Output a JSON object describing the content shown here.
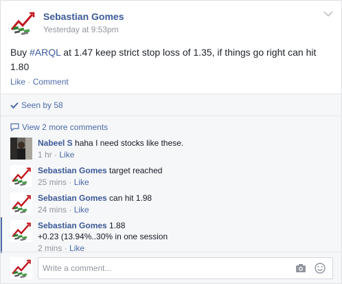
{
  "post": {
    "author": "Sebastian Gomes",
    "timestamp": "Yesterday at 9:53pm",
    "text_before": "Buy ",
    "hashtag": "#ARQL",
    "text_after": " at 1.47 keep strict stop loss of 1.35, if things go right can hit 1.80",
    "like_label": "Like",
    "separator": " · ",
    "comment_label": "Comment"
  },
  "seen_by": "Seen by 58",
  "view_more": "View 2 more comments",
  "comments": [
    {
      "author": "Nabeel S",
      "text": " haha I need stocks like these.",
      "text2": "",
      "time": "1 hr",
      "like": "Like",
      "avatar": "photo-avatar"
    },
    {
      "author": "Sebastian Gomes",
      "text": " target reached",
      "text2": "",
      "time": "25 mins",
      "like": "Like",
      "avatar": "logo-avatar"
    },
    {
      "author": "Sebastian Gomes",
      "text": " can hit 1.98",
      "text2": "",
      "time": "24 mins",
      "like": "Like",
      "avatar": "logo-avatar"
    },
    {
      "author": "Sebastian Gomes",
      "text": " 1.88",
      "text2": "+0.23 (13.94%..30% in one session",
      "time": "2 mins",
      "like": "Like",
      "avatar": "logo-avatar"
    }
  ],
  "composer": {
    "placeholder": "Write a comment..."
  },
  "colors": {
    "link": "#3b5998",
    "meta": "#90949c",
    "accent": "#4b6aa8"
  }
}
